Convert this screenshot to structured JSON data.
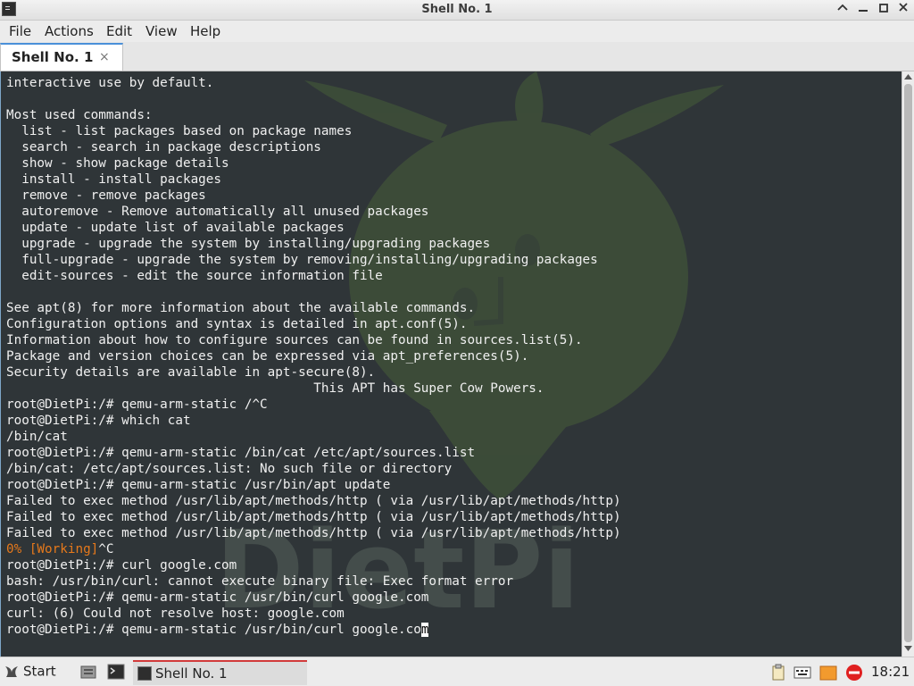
{
  "window": {
    "title": "Shell No. 1"
  },
  "menu": [
    "File",
    "Actions",
    "Edit",
    "View",
    "Help"
  ],
  "tab": {
    "label": "Shell No. 1",
    "close_glyph": "×"
  },
  "terminal": {
    "lines": [
      "interactive use by default.",
      "",
      "Most used commands:",
      "  list - list packages based on package names",
      "  search - search in package descriptions",
      "  show - show package details",
      "  install - install packages",
      "  remove - remove packages",
      "  autoremove - Remove automatically all unused packages",
      "  update - update list of available packages",
      "  upgrade - upgrade the system by installing/upgrading packages",
      "  full-upgrade - upgrade the system by removing/installing/upgrading packages",
      "  edit-sources - edit the source information file",
      "",
      "See apt(8) for more information about the available commands.",
      "Configuration options and syntax is detailed in apt.conf(5).",
      "Information about how to configure sources can be found in sources.list(5).",
      "Package and version choices can be expressed via apt_preferences(5).",
      "Security details are available in apt-secure(8).",
      "                                        This APT has Super Cow Powers.",
      "root@DietPi:/# qemu-arm-static /^C",
      "root@DietPi:/# which cat",
      "/bin/cat",
      "root@DietPi:/# qemu-arm-static /bin/cat /etc/apt/sources.list",
      "/bin/cat: /etc/apt/sources.list: No such file or directory",
      "root@DietPi:/# qemu-arm-static /usr/bin/apt update",
      "Failed to exec method /usr/lib/apt/methods/http ( via /usr/lib/apt/methods/http)",
      "Failed to exec method /usr/lib/apt/methods/http ( via /usr/lib/apt/methods/http)",
      "Failed to exec method /usr/lib/apt/methods/http ( via /usr/lib/apt/methods/http)"
    ],
    "working_line": {
      "highlight": "0% [Working]",
      "rest": "^C"
    },
    "lines_after": [
      "root@DietPi:/# curl google.com",
      "bash: /usr/bin/curl: cannot execute binary file: Exec format error",
      "root@DietPi:/# qemu-arm-static /usr/bin/curl google.com",
      "curl: (6) Could not resolve host: google.com"
    ],
    "prompt_line": {
      "text": "root@DietPi:/# qemu-arm-static /usr/bin/curl google.co",
      "cursor_char": "m"
    },
    "highlight_color": "#e6791b"
  },
  "taskbar": {
    "start_label": "Start",
    "task_label": "Shell No. 1",
    "clock": "18:21"
  }
}
